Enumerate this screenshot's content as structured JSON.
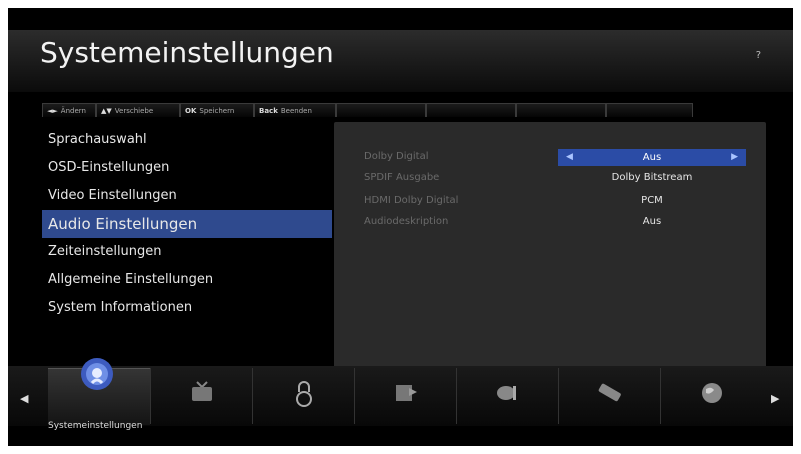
{
  "header": {
    "title": "Systemeinstellungen",
    "help": "?"
  },
  "keybar": [
    {
      "key": "◄►",
      "label": "Ändern"
    },
    {
      "key": "▲▼",
      "label": "Verschiebe"
    },
    {
      "key": "OK",
      "label": "Speichern"
    },
    {
      "key": "Back",
      "label": "Beenden"
    }
  ],
  "menu": [
    "Sprachauswahl",
    "OSD-Einstellungen",
    "Video Einstellungen",
    "Audio Einstellungen",
    "Zeiteinstellungen",
    "Allgemeine Einstellungen",
    "System Informationen"
  ],
  "settings": [
    {
      "label": "Dolby Digital",
      "value": "Aus"
    },
    {
      "label": "SPDIF Ausgabe",
      "value": "Dolby Bitstream"
    },
    {
      "label": "HDMI Dolby Digital",
      "value": "PCM"
    },
    {
      "label": "Audiodeskription",
      "value": "Aus"
    }
  ],
  "tabs": {
    "selected_label": "Systemeinstellungen",
    "icons": [
      "gear-icon",
      "tv-icon",
      "lock-icon",
      "media-icon",
      "dish-icon",
      "remote-icon",
      "globe-icon"
    ]
  },
  "colors": {
    "accent": "#2f4a8e",
    "highlight": "#2b4ca6"
  }
}
